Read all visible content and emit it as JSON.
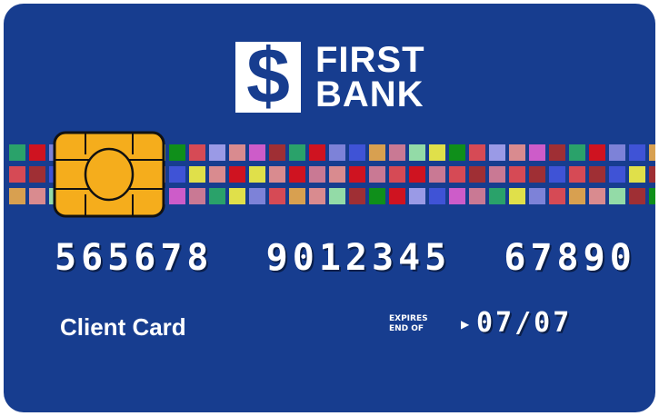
{
  "card": {
    "bank_mark": "$",
    "bank_line1": "FIRST",
    "bank_line2": "BANK",
    "number": "565678  9012345  67890",
    "holder_label": "Client Card",
    "expiry_caption_line1": "EXPIRES",
    "expiry_caption_line2": "END OF",
    "expiry_arrow": "▶",
    "expiry_date": "07/07"
  },
  "colors": {
    "card_background": "#173d8f",
    "chip_gold": "#f5ad1c",
    "text": "#ffffff",
    "mosaic_palette": [
      "#2aa26a",
      "#3f53d6",
      "#93dba7",
      "#d64a55",
      "#cd5cc9",
      "#cf1320",
      "#d8a050",
      "#e0e04a",
      "#9a9ae6",
      "#9f2f34",
      "#7d82d8",
      "#c97994",
      "#0f8f1a",
      "#d98b8f"
    ]
  }
}
